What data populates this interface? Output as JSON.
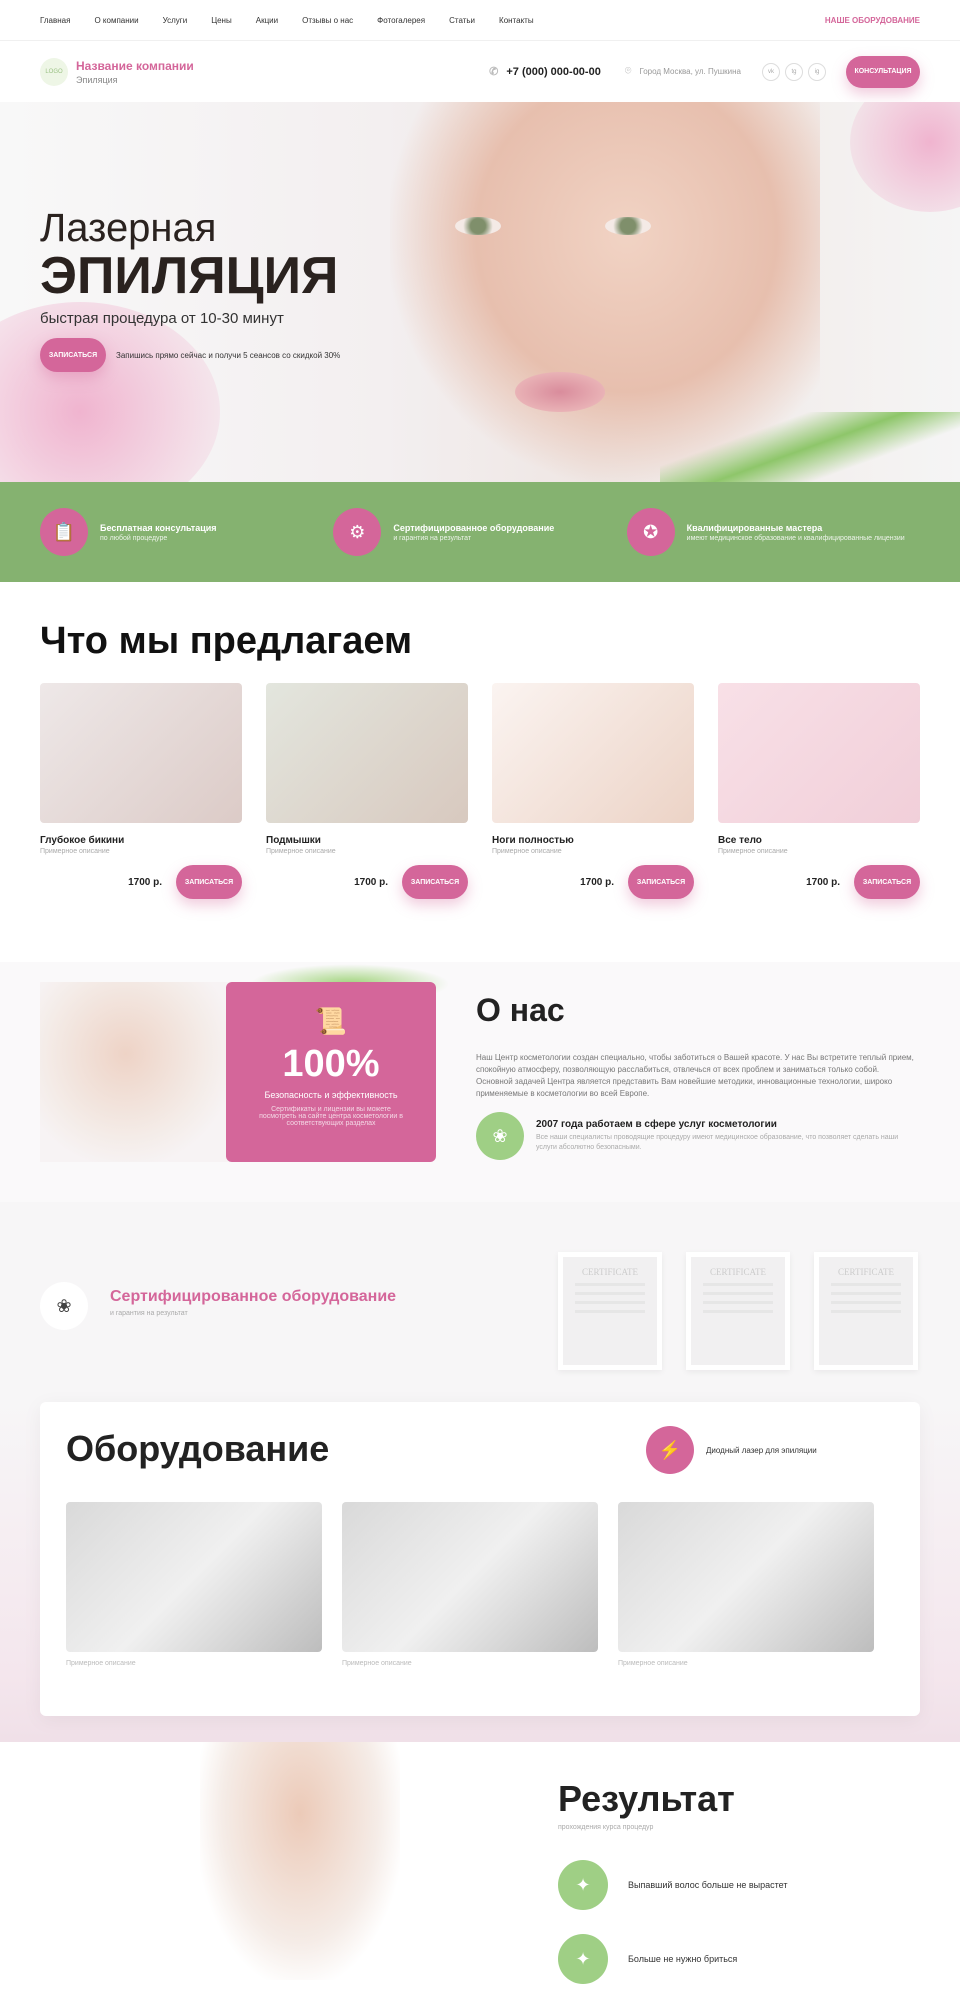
{
  "topnav": {
    "items": [
      "Главная",
      "О компании",
      "Услуги",
      "Цены",
      "Акции",
      "Отзывы о нас",
      "Фотогалерея",
      "Статьи",
      "Контакты"
    ],
    "right_link": "НАШЕ ОБОРУДОВАНИЕ"
  },
  "header": {
    "logo_text": "LOGO",
    "company_name": "Название компании",
    "company_sub": "Эпиляция",
    "phone": "+7 (000) 000-00-00",
    "address": "Город Москва, ул. Пушкина",
    "social": [
      "vk",
      "tg",
      "ig"
    ],
    "consult_button": "Консультация"
  },
  "hero": {
    "title_line1": "Лазерная",
    "title_line2": "ЭПИЛЯЦИЯ",
    "subtitle": "быстрая процедура от 10-30 минут",
    "book_button": "Записаться",
    "note": "Запишись прямо сейчас и получи 5 сеансов со скидкой 30%"
  },
  "features": [
    {
      "title": "Бесплатная консультация",
      "desc": "по любой процедуре",
      "icon": "clipboard-icon"
    },
    {
      "title": "Сертифицированное оборудование",
      "desc": "и гарантия на результат",
      "icon": "device-icon"
    },
    {
      "title": "Квалифицированные мастера",
      "desc": "имеют медицинское образование и квалифицированные лицензии",
      "icon": "award-icon"
    }
  ],
  "offer": {
    "title": "Что мы предлагаем",
    "cards": [
      {
        "name": "Глубокое бикини",
        "desc": "Примерное описание",
        "price": "1700 р.",
        "button": "Записаться",
        "color": "#e9e3e4"
      },
      {
        "name": "Подмышки",
        "desc": "Примерное описание",
        "price": "1700 р.",
        "button": "Записаться",
        "color": "#e2e3dc"
      },
      {
        "name": "Ноги полностью",
        "desc": "Примерное описание",
        "price": "1700 р.",
        "button": "Записаться",
        "color": "#f3ebe7"
      },
      {
        "name": "Все тело",
        "desc": "Примерное описание",
        "price": "1700 р.",
        "button": "Записаться",
        "color": "#f6dfe5"
      }
    ]
  },
  "about": {
    "percent": "100%",
    "percent_label": "Безопасность и эффективность",
    "percent_note": "Сертификаты и лицензии вы можете посмотреть на сайте центра косметологии в соответствующих разделах",
    "title": "О нас",
    "text": "Наш Центр косметологии создан специально, чтобы заботиться о Вашей красоте. У нас Вы встретите теплый прием, спокойную атмосферу, позволяющую расслабиться, отвлечься от всех проблем и заниматься только собой. Основной задачей Центра является представить Вам новейшие методики, инновационные технологии, широко применяемые в косметологии во всей Европе.",
    "year_title": "2007 года работаем в сфере услуг косметологии",
    "year_desc": "Все наши специалисты проводящие процедуру имеют медицинское образование, что позволяет сделать наши услуги абсолютно безопасными."
  },
  "certs": {
    "title": "Сертифицированное оборудование",
    "sub": "и гарантия на результат",
    "cert_label": "CERTIFICATE"
  },
  "equipment": {
    "title": "Оборудование",
    "label": "Диодный лазер для эпиляции",
    "captions": [
      "Примерное описание",
      "Примерное описание",
      "Примерное описание"
    ]
  },
  "result": {
    "title": "Результат",
    "sub": "прохождения курса процедур",
    "items": [
      "Выпавший волос больше не вырастет",
      "Больше не нужно бриться"
    ]
  },
  "colors": {
    "accent": "#d4669a",
    "green": "#85b270"
  }
}
